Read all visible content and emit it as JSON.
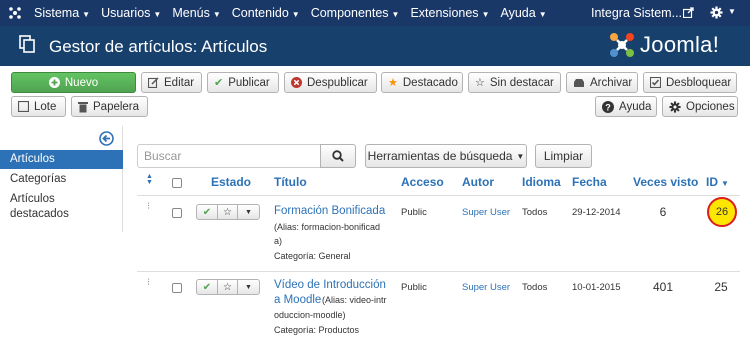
{
  "topbar": {
    "menu": [
      "Sistema",
      "Usuarios",
      "Menús",
      "Contenido",
      "Componentes",
      "Extensiones",
      "Ayuda"
    ],
    "site_name": "Integra Sistem..."
  },
  "header": {
    "title": "Gestor de artículos: Artículos",
    "brand": "Joomla!"
  },
  "toolbar": {
    "new": "Nuevo",
    "edit": "Editar",
    "publish": "Publicar",
    "unpublish": "Despublicar",
    "feature": "Destacado",
    "unfeature": "Sin destacar",
    "archive": "Archivar",
    "checkin": "Desbloquear",
    "batch": "Lote",
    "trash": "Papelera",
    "help": "Ayuda",
    "options": "Opciones"
  },
  "sidebar": {
    "items": [
      "Artículos",
      "Categorías",
      "Artículos destacados"
    ],
    "active_index": 0
  },
  "filters": {
    "search_placeholder": "Buscar",
    "search_tools": "Herramientas de búsqueda",
    "clear": "Limpiar"
  },
  "table": {
    "columns": {
      "status": "Estado",
      "title": "Título",
      "access": "Acceso",
      "author": "Autor",
      "language": "Idioma",
      "date": "Fecha",
      "hits": "Veces visto",
      "id": "ID"
    },
    "rows": [
      {
        "title_lines": [
          "Formación Bonificada"
        ],
        "alias_lines": [
          "(Alias: formacion-bonificad",
          "a)"
        ],
        "category": "Categoría: General",
        "access": "Public",
        "author": "Super User",
        "language": "Todos",
        "date": "29-12-2014",
        "hits": "6",
        "id": "26"
      },
      {
        "title_lines": [
          "Vídeo de Introducción",
          "a Moodle"
        ],
        "alias_lines": [
          "(Alias: video-intr",
          "oduccion-moodle)"
        ],
        "category": "Categoría: Productos",
        "access": "Public",
        "author": "Super User",
        "language": "Todos",
        "date": "10-01-2015",
        "hits": "401",
        "id": "25"
      }
    ]
  },
  "colors": {
    "topbar": "#1a3867",
    "header": "#17406c",
    "link": "#2d72b6",
    "new_button": "#51a351",
    "id_highlight": "#ffe600",
    "id_highlight_border": "#d81e1e"
  }
}
